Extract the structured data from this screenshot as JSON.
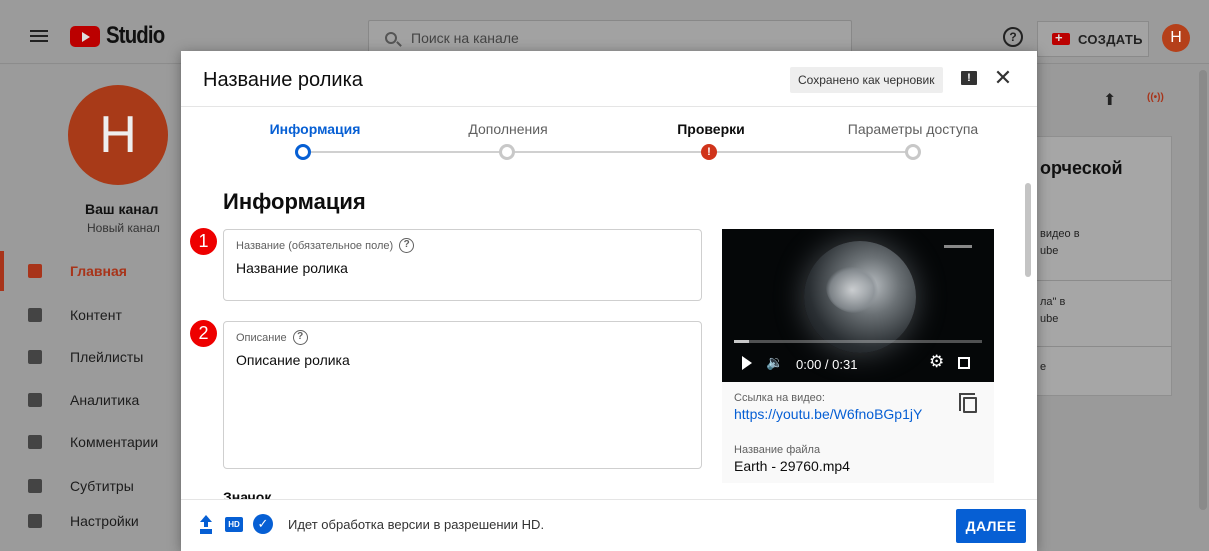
{
  "app": {
    "logo_text": "Studio",
    "search_placeholder": "Поиск на канале",
    "create_label": "СОЗДАТЬ",
    "avatar_letter": "H"
  },
  "sidebar": {
    "avatar_letter": "H",
    "channel_name": "Ваш канал",
    "channel_subtitle": "Новый канал",
    "items": [
      {
        "label": "Главная",
        "icon": "dashboard-icon",
        "active": true
      },
      {
        "label": "Контент",
        "icon": "content-icon",
        "active": false
      },
      {
        "label": "Плейлисты",
        "icon": "playlists-icon",
        "active": false
      },
      {
        "label": "Аналитика",
        "icon": "analytics-icon",
        "active": false
      },
      {
        "label": "Комментарии",
        "icon": "comments-icon",
        "active": false
      },
      {
        "label": "Субтитры",
        "icon": "subtitles-icon",
        "active": false
      },
      {
        "label": "Настройки",
        "icon": "settings-icon",
        "active": false
      }
    ]
  },
  "background_panel": {
    "title": "орческой",
    "lines": [
      "видео в",
      "ube",
      "ла\" в",
      "ube",
      "e"
    ]
  },
  "dialog": {
    "title": "Название ролика",
    "saved_badge": "Сохранено как черновик",
    "steps": [
      {
        "label": "Информация",
        "state": "active"
      },
      {
        "label": "Дополнения",
        "state": "pending"
      },
      {
        "label": "Проверки",
        "state": "error"
      },
      {
        "label": "Параметры доступа",
        "state": "pending"
      }
    ],
    "section_title": "Информация",
    "title_field": {
      "marker": "1",
      "label": "Название (обязательное поле)",
      "value": "Название ролика"
    },
    "description_field": {
      "marker": "2",
      "label": "Описание",
      "value": "Описание ролика"
    },
    "thumbnail_label": "Значок",
    "video": {
      "time": "0:00 / 0:31",
      "progress": 0.06,
      "link_label": "Ссылка на видео:",
      "link": "https://youtu.be/W6fnoBGp1jY",
      "filename_label": "Название файла",
      "filename": "Earth - 29760.mp4"
    },
    "footer": {
      "hd_badge": "HD",
      "status": "Идет обработка версии в разрешении HD.",
      "next_label": "ДАЛЕЕ"
    }
  },
  "colors": {
    "accent": "#065fd4",
    "error": "#d0341b",
    "marker": "#e00000",
    "brand": "#a8341a"
  }
}
